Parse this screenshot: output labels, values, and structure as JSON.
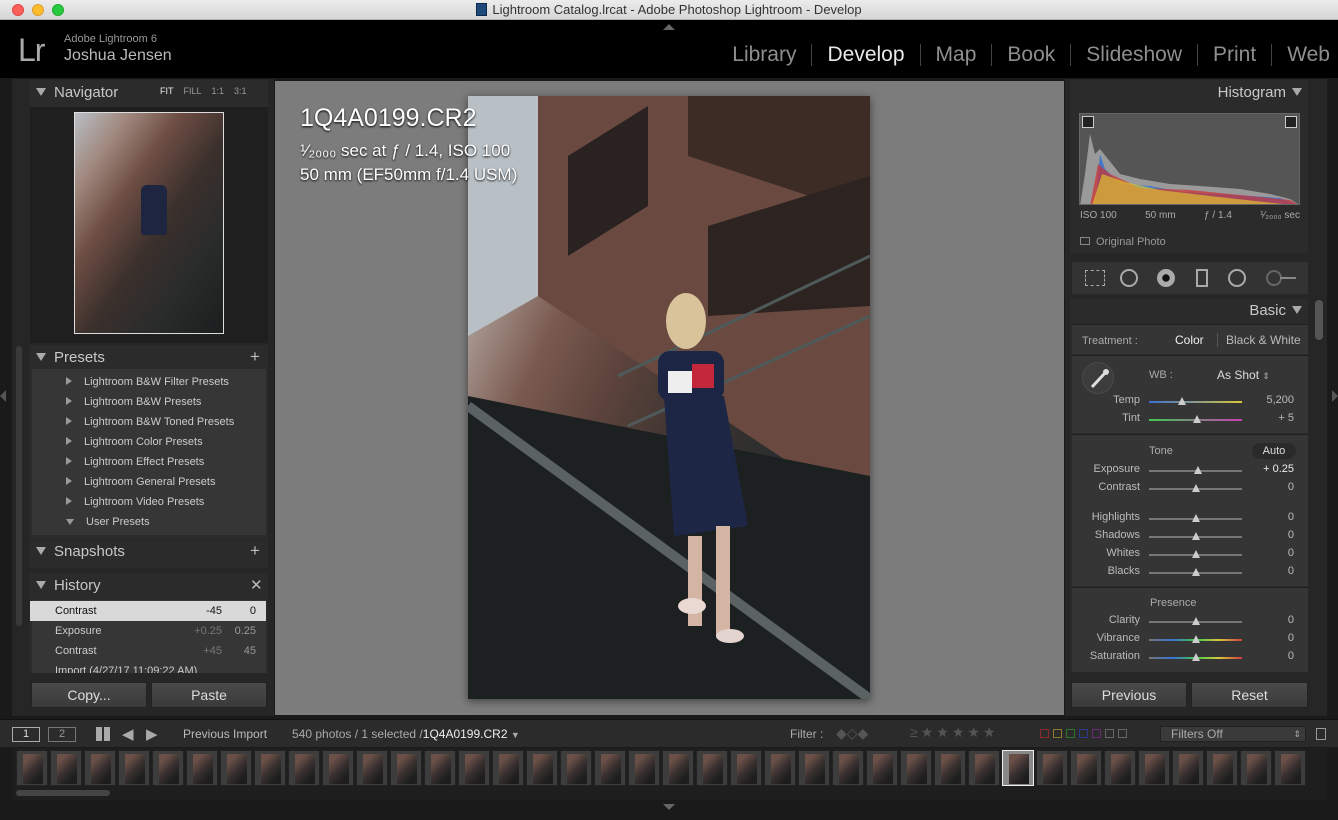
{
  "window": {
    "title": "Lightroom Catalog.lrcat - Adobe Photoshop Lightroom - Develop"
  },
  "identity": {
    "logo": "Lr",
    "app_name": "Adobe Lightroom 6",
    "user": "Joshua Jensen"
  },
  "modules": [
    "Library",
    "Develop",
    "Map",
    "Book",
    "Slideshow",
    "Print",
    "Web"
  ],
  "active_module": "Develop",
  "navigator": {
    "title": "Navigator",
    "zoom": [
      "FIT",
      "FILL",
      "1:1",
      "3:1"
    ]
  },
  "presets": {
    "title": "Presets",
    "items": [
      "Lightroom B&W Filter Presets",
      "Lightroom B&W Presets",
      "Lightroom B&W Toned Presets",
      "Lightroom Color Presets",
      "Lightroom Effect Presets",
      "Lightroom General Presets",
      "Lightroom Video Presets",
      "User Presets"
    ]
  },
  "snapshots": {
    "title": "Snapshots"
  },
  "history": {
    "title": "History",
    "rows": [
      {
        "name": "Contrast",
        "delta": "-45",
        "value": "0"
      },
      {
        "name": "Exposure",
        "delta": "+0.25",
        "value": "0.25"
      },
      {
        "name": "Contrast",
        "delta": "+45",
        "value": "45"
      },
      {
        "name": "Import (4/27/17 11:09:22 AM)",
        "delta": "",
        "value": ""
      }
    ]
  },
  "left_buttons": {
    "copy": "Copy...",
    "paste": "Paste"
  },
  "photo_info": {
    "filename": "1Q4A0199.CR2",
    "exposure": "¹⁄₂₀₀₀ sec at ƒ / 1.4, ISO 100",
    "lens": "50 mm (EF50mm f/1.4 USM)"
  },
  "histogram": {
    "title": "Histogram",
    "iso": "ISO 100",
    "focal": "50 mm",
    "aperture": "ƒ / 1.4",
    "shutter": "¹⁄₂₀₀₀ sec",
    "original_photo": "Original Photo"
  },
  "basic": {
    "title": "Basic",
    "treatment_label": "Treatment :",
    "color": "Color",
    "bw": "Black & White",
    "wb_label": "WB :",
    "wb_value": "As Shot",
    "tone_label": "Tone",
    "auto": "Auto",
    "presence_label": "Presence",
    "sliders": [
      {
        "label": "Temp",
        "value": "5,200",
        "pos": 0.35
      },
      {
        "label": "Tint",
        "value": "+ 5",
        "pos": 0.52
      },
      {
        "label": "Exposure",
        "value": "+ 0.25",
        "pos": 0.53
      },
      {
        "label": "Contrast",
        "value": "0",
        "pos": 0.5
      },
      {
        "label": "Highlights",
        "value": "0",
        "pos": 0.5
      },
      {
        "label": "Shadows",
        "value": "0",
        "pos": 0.5
      },
      {
        "label": "Whites",
        "value": "0",
        "pos": 0.5
      },
      {
        "label": "Blacks",
        "value": "0",
        "pos": 0.5
      },
      {
        "label": "Clarity",
        "value": "0",
        "pos": 0.5
      },
      {
        "label": "Vibrance",
        "value": "0",
        "pos": 0.5
      },
      {
        "label": "Saturation",
        "value": "0",
        "pos": 0.5
      }
    ]
  },
  "right_buttons": {
    "previous": "Previous",
    "reset": "Reset"
  },
  "filmstrip": {
    "page1": "1",
    "page2": "2",
    "source": "Previous Import",
    "count": "540 photos / 1 selected /",
    "selected_file": "1Q4A0199.CR2",
    "filter_label": "Filter :",
    "filters_off": "Filters Off",
    "thumb_count": 38,
    "selected_index": 29
  },
  "colors": {
    "accent": "#e8e8e8",
    "panel": "#2b2b2b",
    "selected_row": "#d9d9d9"
  }
}
